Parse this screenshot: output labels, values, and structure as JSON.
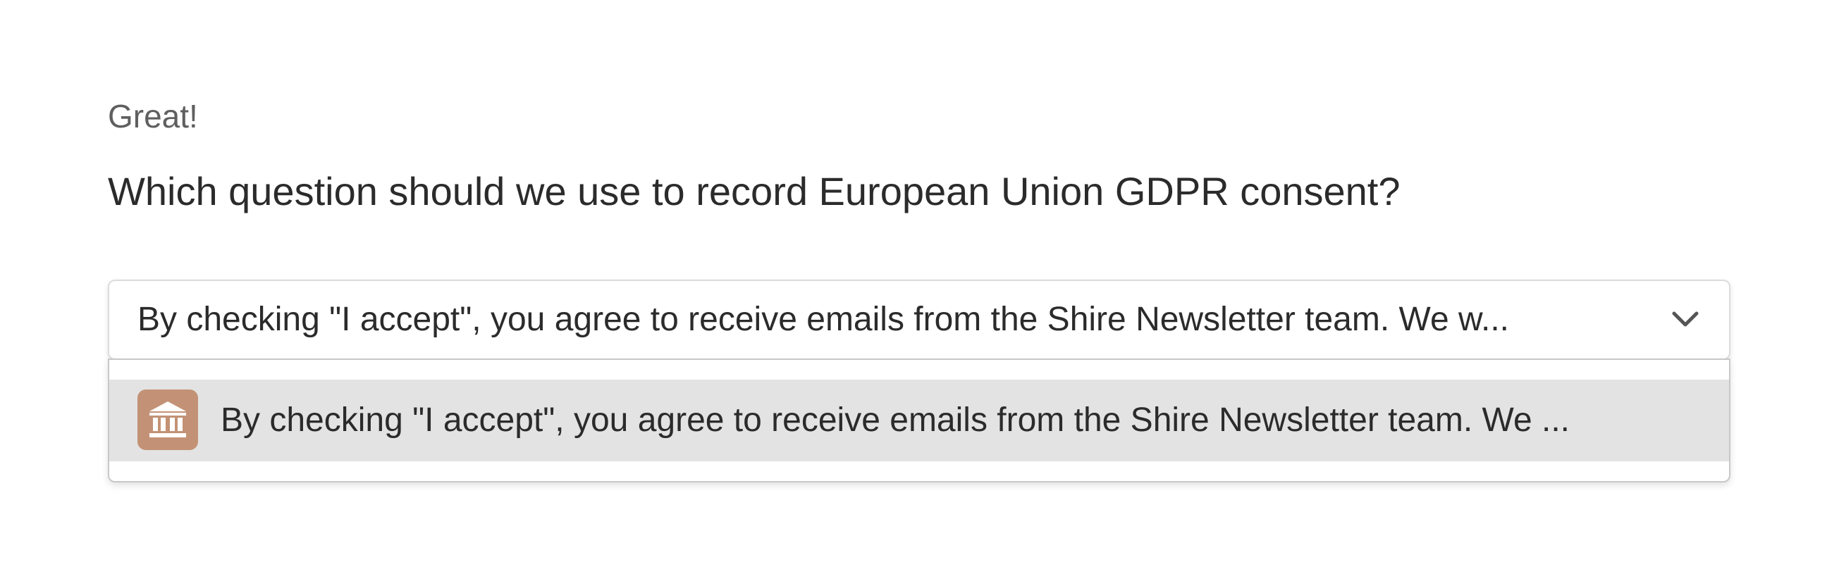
{
  "intro": {
    "text": "Great!"
  },
  "question": {
    "text": "Which question should we use to record European Union GDPR consent?"
  },
  "select": {
    "selected_value": "By checking \"I accept\", you agree to receive emails from the Shire Newsletter team. We w...",
    "icon": "chevron-down-icon",
    "options": [
      {
        "label": "By checking \"I accept\", you agree to receive emails from the Shire Newsletter team. We ...",
        "icon": "bank-building-icon",
        "icon_color": "#c39276",
        "highlighted": true
      }
    ]
  },
  "colors": {
    "text_primary": "#2b2b2b",
    "text_secondary": "#5f5f5f",
    "option_highlight": "#e3e3e3",
    "icon_badge": "#c39276"
  }
}
